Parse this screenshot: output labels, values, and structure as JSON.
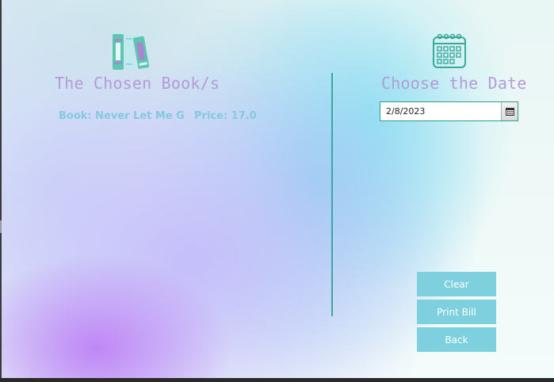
{
  "left_panel": {
    "title": "The Chosen Book/s",
    "book_label": "Book: Never Let Me G",
    "price_label": "Price: 17.0"
  },
  "right_panel": {
    "title": "Choose the Date",
    "date_value": "2/8/2023"
  },
  "buttons": {
    "clear": "Clear",
    "print_bill": "Print Bill",
    "back": "Back"
  },
  "icons": {
    "books": "books-icon",
    "calendar": "calendar-icon",
    "date_picker": "calendar-small-icon"
  },
  "colors": {
    "title": "#b39ad8",
    "book_text": "#84c9e0",
    "accent_teal": "#2d9d8c",
    "button_bg": "#7fd0df"
  }
}
